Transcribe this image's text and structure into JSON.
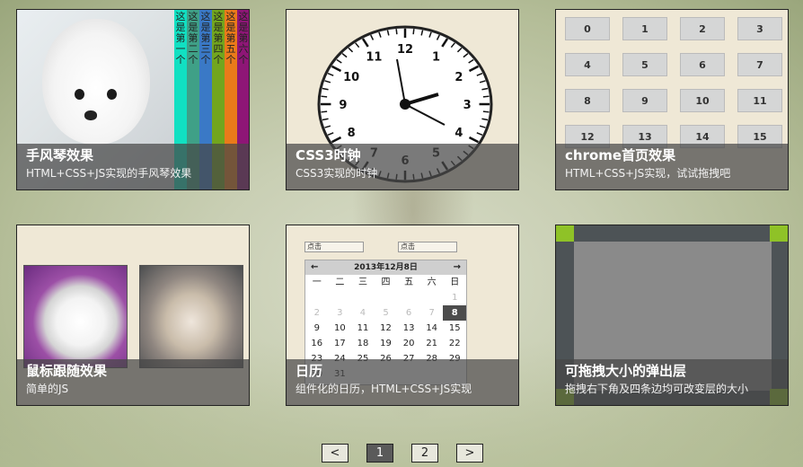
{
  "cards": [
    {
      "title": "手风琴效果",
      "subtitle": "HTML+CSS+JS实现的手风琴效果",
      "strips": [
        {
          "label": "这是第一个",
          "color": "#11e0c2"
        },
        {
          "label": "这是第二个",
          "color": "#3fa087"
        },
        {
          "label": "这是第三个",
          "color": "#3a79c6"
        },
        {
          "label": "这是第四个",
          "color": "#72a51e"
        },
        {
          "label": "这是第五个",
          "color": "#ea7a1a"
        },
        {
          "label": "这是第六个",
          "color": "#8e1676"
        }
      ]
    },
    {
      "title": "CSS3时钟",
      "subtitle": "CSS3实现的时钟",
      "numbers": [
        "12",
        "1",
        "2",
        "3",
        "4",
        "5",
        "6",
        "7",
        "8",
        "9",
        "10",
        "11"
      ]
    },
    {
      "title": "chrome首页效果",
      "subtitle": "HTML+CSS+JS实现，试试拖拽吧",
      "tiles": [
        "0",
        "1",
        "2",
        "3",
        "4",
        "5",
        "6",
        "7",
        "8",
        "9",
        "10",
        "11",
        "12",
        "13",
        "14",
        "15"
      ]
    },
    {
      "title": "鼠标跟随效果",
      "subtitle": "简单的JS"
    },
    {
      "title": "日历",
      "subtitle": "组件化的日历，HTML+CSS+JS实现",
      "input_left": "点击",
      "input_right": "点击",
      "month_label": "2013年12月8日",
      "prev": "←",
      "next": "→",
      "weekdays": [
        "一",
        "二",
        "三",
        "四",
        "五",
        "六",
        "日"
      ],
      "weeks": [
        [
          "",
          "",
          "",
          "",
          "",
          "",
          "1"
        ],
        [
          "2",
          "3",
          "4",
          "5",
          "6",
          "7",
          "8"
        ],
        [
          "9",
          "10",
          "11",
          "12",
          "13",
          "14",
          "15"
        ],
        [
          "16",
          "17",
          "18",
          "19",
          "20",
          "21",
          "22"
        ],
        [
          "23",
          "24",
          "25",
          "26",
          "27",
          "28",
          "29"
        ],
        [
          "30",
          "31",
          "",
          "",
          "",
          "",
          ""
        ]
      ],
      "selected": "8"
    },
    {
      "title": "可拖拽大小的弹出层",
      "subtitle": "拖拽右下角及四条边均可改变层的大小"
    }
  ],
  "pager": {
    "prev": "<",
    "pages": [
      "1",
      "2"
    ],
    "next": ">",
    "current": "1"
  }
}
